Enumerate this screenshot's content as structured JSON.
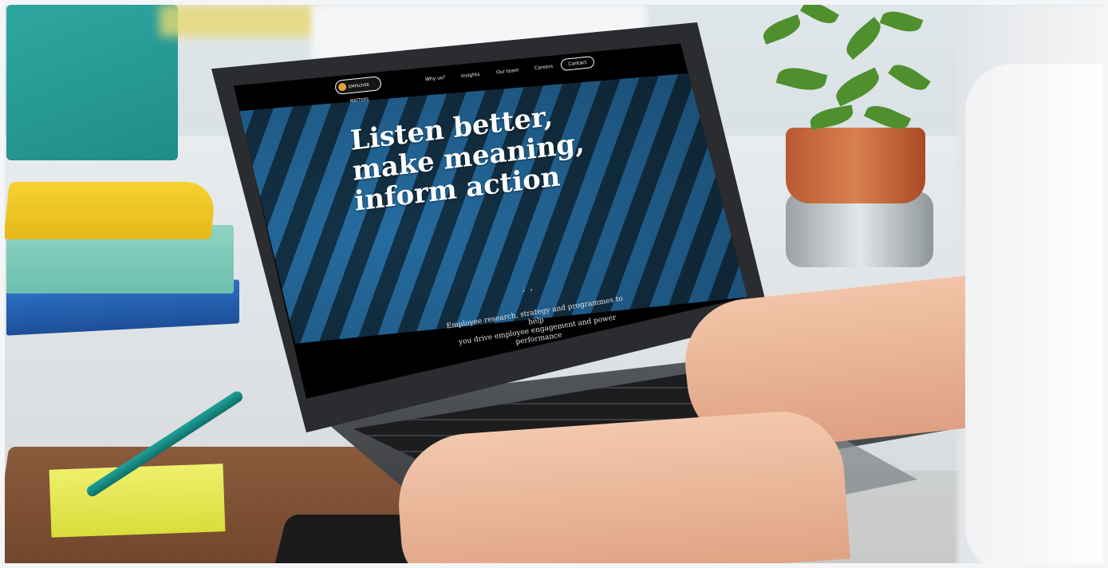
{
  "website": {
    "logo_text": "EMPLOYEE MATTERS",
    "nav": [
      "Why us?",
      "Insights",
      "Our team",
      "Careers"
    ],
    "nav_contact": "Contact",
    "headline_lines": [
      "Listen better,",
      "make meaning,",
      "inform action"
    ],
    "subtext_lines": [
      "Employee research, strategy and programmes to help",
      "you drive employee engagement and power",
      "performance"
    ]
  },
  "colors": {
    "nav_blue": "#2f9be0",
    "hero_blue": "#2b7fbd",
    "pot_terracotta": "#c96a3c",
    "sticky_note": "#e3e64f",
    "pen_teal": "#1fa39a"
  }
}
